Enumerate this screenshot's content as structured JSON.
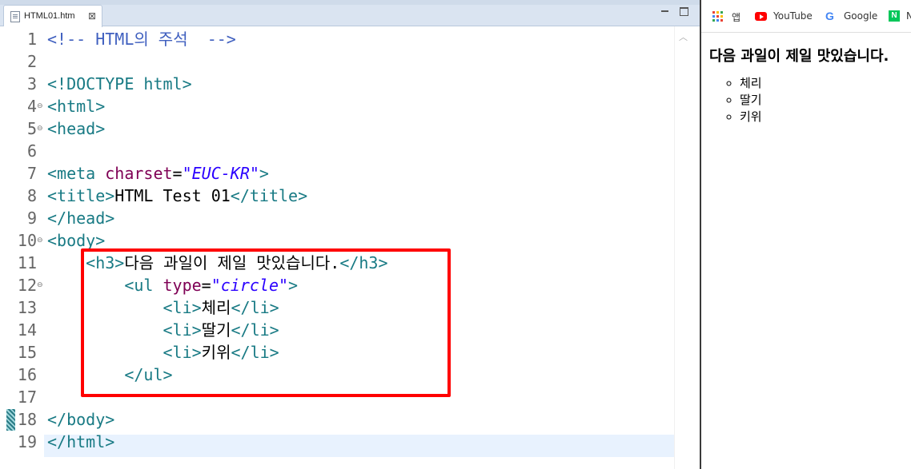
{
  "editor": {
    "tab": {
      "title": "HTML01.htm",
      "close": "⊠"
    },
    "lines": [
      {
        "n": "1",
        "fold": "",
        "tokens": [
          {
            "t": "<!-- HTML의 주석  -->",
            "c": "c-com"
          }
        ]
      },
      {
        "n": "2",
        "fold": "",
        "tokens": []
      },
      {
        "n": "3",
        "fold": "",
        "tokens": [
          {
            "t": "<!DOCTYPE ",
            "c": "c-tag"
          },
          {
            "t": "html",
            "c": "c-tag"
          },
          {
            "t": ">",
            "c": "c-tag"
          }
        ]
      },
      {
        "n": "4",
        "fold": "⊖",
        "tokens": [
          {
            "t": "<html>",
            "c": "c-tag"
          }
        ]
      },
      {
        "n": "5",
        "fold": "⊖",
        "tokens": [
          {
            "t": "<head>",
            "c": "c-tag"
          }
        ]
      },
      {
        "n": "6",
        "fold": "",
        "tokens": []
      },
      {
        "n": "7",
        "fold": "",
        "tokens": [
          {
            "t": "<meta ",
            "c": "c-tag"
          },
          {
            "t": "charset",
            "c": "c-attr"
          },
          {
            "t": "=",
            "c": "c-txt"
          },
          {
            "t": "\"EUC-KR\"",
            "c": "c-val"
          },
          {
            "t": ">",
            "c": "c-tag"
          }
        ]
      },
      {
        "n": "8",
        "fold": "",
        "tokens": [
          {
            "t": "<title>",
            "c": "c-tag"
          },
          {
            "t": "HTML Test 01",
            "c": "c-txt"
          },
          {
            "t": "</title>",
            "c": "c-tag"
          }
        ]
      },
      {
        "n": "9",
        "fold": "",
        "tokens": [
          {
            "t": "</head>",
            "c": "c-tag"
          }
        ]
      },
      {
        "n": "10",
        "fold": "⊖",
        "tokens": [
          {
            "t": "<body>",
            "c": "c-tag"
          }
        ]
      },
      {
        "n": "11",
        "fold": "",
        "tokens": [
          {
            "t": "    ",
            "c": "c-txt"
          },
          {
            "t": "<h3>",
            "c": "c-tag"
          },
          {
            "t": "다음 과일이 제일 맛있습니다.",
            "c": "c-txt"
          },
          {
            "t": "</h3>",
            "c": "c-tag"
          }
        ]
      },
      {
        "n": "12",
        "fold": "⊖",
        "tokens": [
          {
            "t": "        ",
            "c": "c-txt"
          },
          {
            "t": "<ul ",
            "c": "c-tag"
          },
          {
            "t": "type",
            "c": "c-attr"
          },
          {
            "t": "=",
            "c": "c-txt"
          },
          {
            "t": "\"circle\"",
            "c": "c-val"
          },
          {
            "t": ">",
            "c": "c-tag"
          }
        ]
      },
      {
        "n": "13",
        "fold": "",
        "tokens": [
          {
            "t": "            ",
            "c": "c-txt"
          },
          {
            "t": "<li>",
            "c": "c-tag"
          },
          {
            "t": "체리",
            "c": "c-txt"
          },
          {
            "t": "</li>",
            "c": "c-tag"
          }
        ]
      },
      {
        "n": "14",
        "fold": "",
        "tokens": [
          {
            "t": "            ",
            "c": "c-txt"
          },
          {
            "t": "<li>",
            "c": "c-tag"
          },
          {
            "t": "딸기",
            "c": "c-txt"
          },
          {
            "t": "</li>",
            "c": "c-tag"
          }
        ]
      },
      {
        "n": "15",
        "fold": "",
        "tokens": [
          {
            "t": "            ",
            "c": "c-txt"
          },
          {
            "t": "<li>",
            "c": "c-tag"
          },
          {
            "t": "키위",
            "c": "c-txt"
          },
          {
            "t": "</li>",
            "c": "c-tag"
          }
        ]
      },
      {
        "n": "16",
        "fold": "",
        "tokens": [
          {
            "t": "        ",
            "c": "c-txt"
          },
          {
            "t": "</ul>",
            "c": "c-tag"
          }
        ]
      },
      {
        "n": "17",
        "fold": "",
        "tokens": []
      },
      {
        "n": "18",
        "fold": "",
        "tokens": [
          {
            "t": "</body>",
            "c": "c-tag"
          }
        ]
      },
      {
        "n": "19",
        "fold": "",
        "tokens": [
          {
            "t": "</html>",
            "c": "c-tag"
          }
        ]
      }
    ],
    "current_line": "18",
    "highlight_color": "#ff0000"
  },
  "browser": {
    "bookmarks": [
      {
        "label": "앱",
        "icon": "apps-grid-icon"
      },
      {
        "label": "YouTube",
        "icon": "youtube-icon"
      },
      {
        "label": "Google",
        "icon": "google-icon"
      },
      {
        "label": "N",
        "icon": "naver-icon"
      }
    ],
    "page": {
      "heading": "다음 과일이 제일 맛있습니다.",
      "items": [
        "체리",
        "딸기",
        "키위"
      ]
    }
  },
  "colors": {
    "tag": "#187a84",
    "comment": "#3f5fbf",
    "attribute": "#7f0055",
    "value": "#2a00ff"
  }
}
